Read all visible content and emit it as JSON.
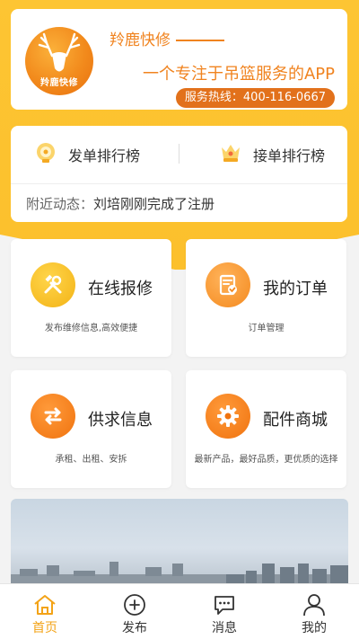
{
  "header": {
    "logo_text": "羚鹿快修",
    "app_name": "羚鹿快修",
    "slogan": "一个专注于吊篮服务的APP",
    "hotline": "服务热线：400-116-0667"
  },
  "rankings": {
    "left_label": "发单排行榜",
    "right_label": "接单排行榜",
    "nearby_label": "附近动态：",
    "nearby_text": "刘培刚刚完成了注册"
  },
  "features": [
    {
      "title": "在线报修",
      "desc": "发布维修信息,高效便捷",
      "icon": "tools-icon"
    },
    {
      "title": "我的订单",
      "desc": "订单管理",
      "icon": "order-icon"
    },
    {
      "title": "供求信息",
      "desc": "承租、出租、安拆",
      "icon": "exchange-icon"
    },
    {
      "title": "配件商城",
      "desc": "最新产品，最好品质，更优质的选择",
      "icon": "gear-icon"
    }
  ],
  "tabs": [
    {
      "label": "首页",
      "icon": "home-icon",
      "active": true
    },
    {
      "label": "发布",
      "icon": "plus-circle-icon",
      "active": false
    },
    {
      "label": "消息",
      "icon": "message-icon",
      "active": false
    },
    {
      "label": "我的",
      "icon": "user-icon",
      "active": false
    }
  ],
  "colors": {
    "brand_yellow": "#fdc533",
    "brand_orange": "#f0831f",
    "hotline_bg": "#e2711b",
    "tab_active": "#f3a317"
  }
}
